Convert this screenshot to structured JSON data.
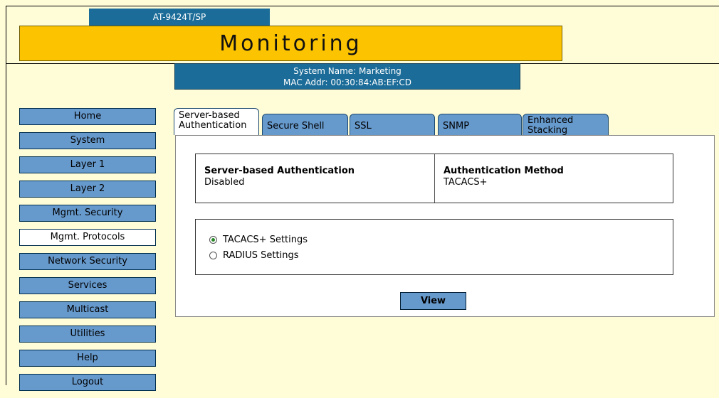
{
  "header": {
    "model": "AT-9424T/SP",
    "page_title": "Monitoring",
    "system_name": "System Name: Marketing",
    "mac_addr": "MAC Addr: 00:30:84:AB:EF:CD"
  },
  "nav": {
    "items": [
      {
        "label": "Home"
      },
      {
        "label": "System"
      },
      {
        "label": "Layer 1"
      },
      {
        "label": "Layer 2"
      },
      {
        "label": "Mgmt. Security"
      },
      {
        "label": "Mgmt. Protocols",
        "active": true
      },
      {
        "label": "Network Security"
      },
      {
        "label": "Services"
      },
      {
        "label": "Multicast"
      },
      {
        "label": "Utilities"
      },
      {
        "label": "Help"
      },
      {
        "label": "Logout"
      }
    ]
  },
  "tabs": [
    {
      "line1": "Server-based",
      "line2": "Authentication",
      "active": true
    },
    {
      "line1": "",
      "line2": "Secure Shell"
    },
    {
      "line1": "",
      "line2": "SSL"
    },
    {
      "line1": "",
      "line2": "SNMP"
    },
    {
      "line1": "Enhanced",
      "line2": "Stacking"
    }
  ],
  "auth": {
    "sba_label": "Server-based Authentication",
    "sba_value": "Disabled",
    "method_label": "Authentication Method",
    "method_value": "TACACS+"
  },
  "settings": {
    "options": [
      "TACACS+ Settings",
      "RADIUS Settings"
    ],
    "selected": "TACACS+ Settings"
  },
  "actions": {
    "view_label": "View"
  },
  "colors": {
    "accent_blue": "#1b6c98",
    "nav_blue": "#6699cc",
    "title_yellow": "#fcc400",
    "page_bg": "#fffcd8"
  }
}
